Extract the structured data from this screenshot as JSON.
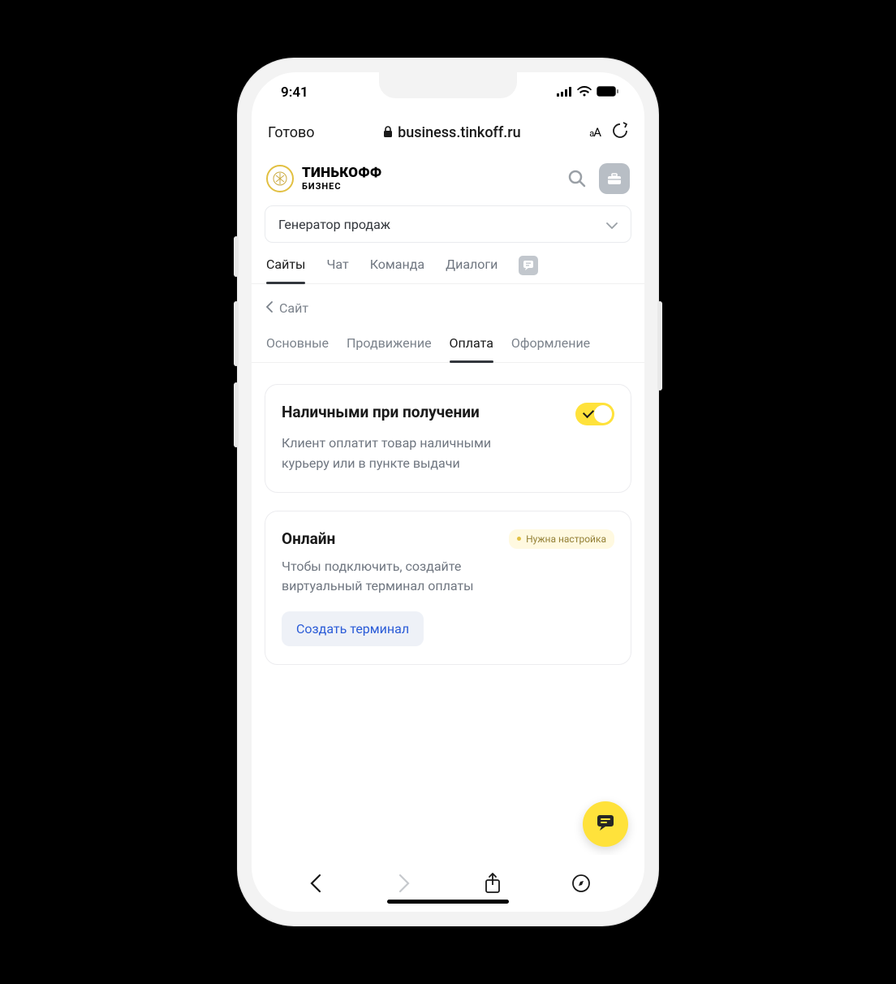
{
  "status": {
    "time": "9:41"
  },
  "safari": {
    "done": "Готово",
    "url": "business.tinkoff.ru",
    "aA": "aA"
  },
  "brand": {
    "line1": "ТИНЬКОФФ",
    "line2": "БИЗНЕС"
  },
  "selector": {
    "value": "Генератор продаж"
  },
  "primary_tabs": {
    "t0": "Сайты",
    "t1": "Чат",
    "t2": "Команда",
    "t3": "Диалоги"
  },
  "breadcrumb": {
    "label": "Сайт"
  },
  "secondary_tabs": {
    "t0": "Основные",
    "t1": "Продвижение",
    "t2": "Оплата",
    "t3": "Оформление"
  },
  "card_cash": {
    "title": "Наличными при получении",
    "desc": "Клиент оплатит товар наличными курьеру или в пункте выдачи"
  },
  "card_online": {
    "title": "Онлайн",
    "badge": "Нужна настройка",
    "desc": "Чтобы подключить, создайте виртуальный терминал оплаты",
    "button": "Создать терминал"
  }
}
